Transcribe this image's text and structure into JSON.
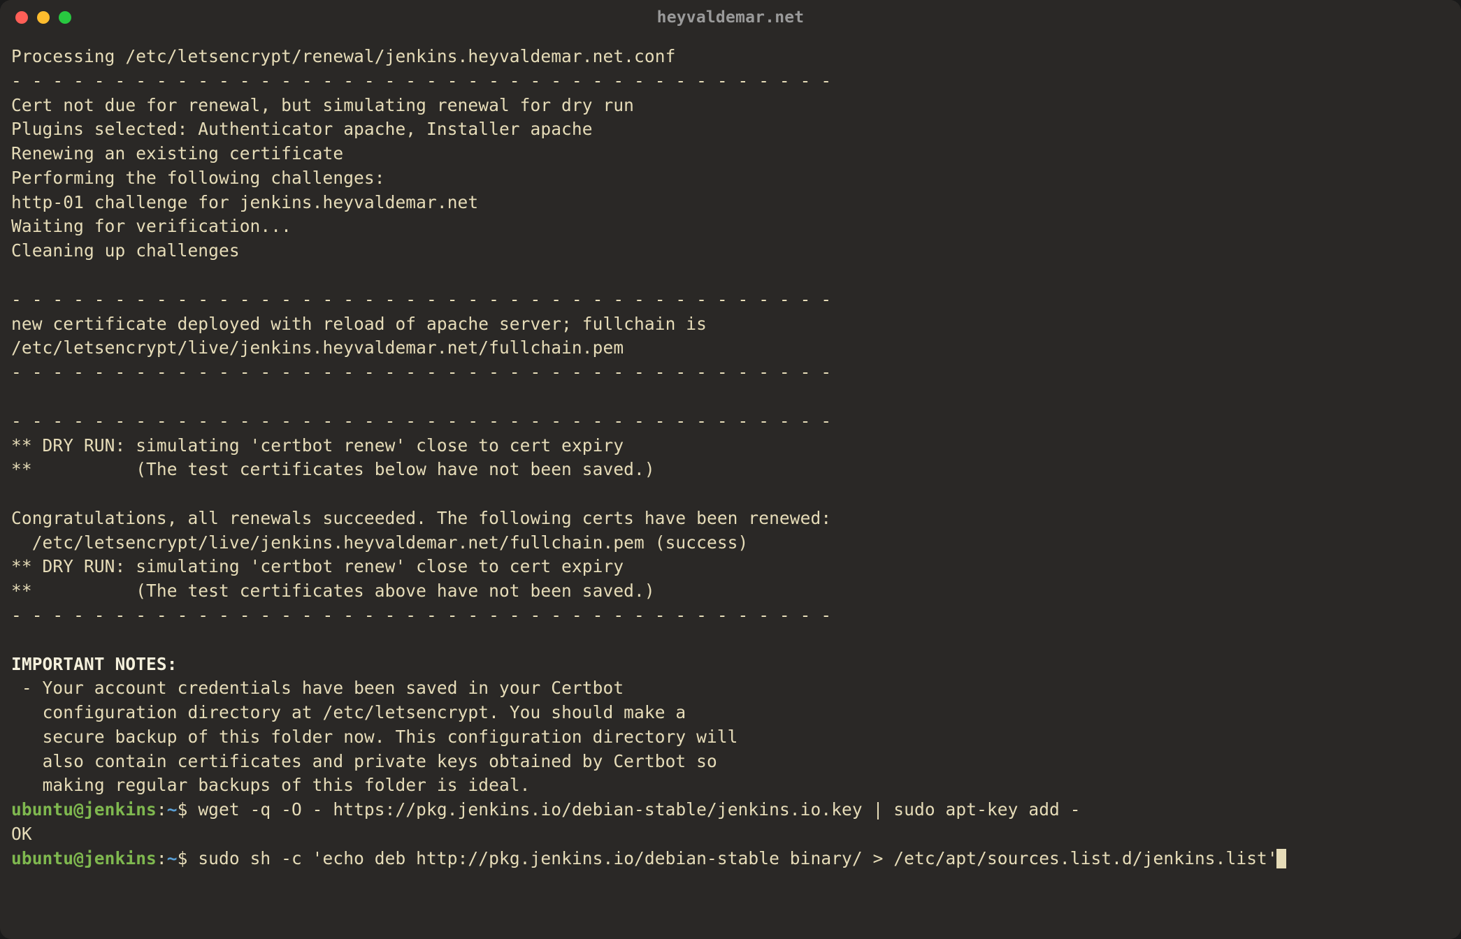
{
  "window": {
    "title": "heyvaldemar.net"
  },
  "output": {
    "line1": "Processing /etc/letsencrypt/renewal/jenkins.heyvaldemar.net.conf",
    "dash1": "- - - - - - - - - - - - - - - - - - - - - - - - - - - - - - - - - - - - - - - -",
    "line2": "Cert not due for renewal, but simulating renewal for dry run",
    "line3": "Plugins selected: Authenticator apache, Installer apache",
    "line4": "Renewing an existing certificate",
    "line5": "Performing the following challenges:",
    "line6": "http-01 challenge for jenkins.heyvaldemar.net",
    "line7": "Waiting for verification...",
    "line8": "Cleaning up challenges",
    "blank1": "",
    "dash2": "- - - - - - - - - - - - - - - - - - - - - - - - - - - - - - - - - - - - - - - -",
    "line9": "new certificate deployed with reload of apache server; fullchain is",
    "line10": "/etc/letsencrypt/live/jenkins.heyvaldemar.net/fullchain.pem",
    "dash3": "- - - - - - - - - - - - - - - - - - - - - - - - - - - - - - - - - - - - - - - -",
    "blank2": "",
    "dash4": "- - - - - - - - - - - - - - - - - - - - - - - - - - - - - - - - - - - - - - - -",
    "line11": "** DRY RUN: simulating 'certbot renew' close to cert expiry",
    "line12": "**          (The test certificates below have not been saved.)",
    "blank3": "",
    "line13": "Congratulations, all renewals succeeded. The following certs have been renewed:",
    "line14": "  /etc/letsencrypt/live/jenkins.heyvaldemar.net/fullchain.pem (success)",
    "line15": "** DRY RUN: simulating 'certbot renew' close to cert expiry",
    "line16": "**          (The test certificates above have not been saved.)",
    "dash5": "- - - - - - - - - - - - - - - - - - - - - - - - - - - - - - - - - - - - - - - -",
    "blank4": "",
    "notes_header": "IMPORTANT NOTES:",
    "note1": " - Your account credentials have been saved in your Certbot",
    "note2": "   configuration directory at /etc/letsencrypt. You should make a",
    "note3": "   secure backup of this folder now. This configuration directory will",
    "note4": "   also contain certificates and private keys obtained by Certbot so",
    "note5": "   making regular backups of this folder is ideal."
  },
  "prompts": [
    {
      "user_host": "ubuntu@jenkins",
      "colon": ":",
      "path": "~",
      "dollar": "$ ",
      "command": "wget -q -O - https://pkg.jenkins.io/debian-stable/jenkins.io.key | sudo apt-key add -"
    },
    {
      "result": "OK"
    },
    {
      "user_host": "ubuntu@jenkins",
      "colon": ":",
      "path": "~",
      "dollar": "$ ",
      "command": "sudo sh -c 'echo deb http://pkg.jenkins.io/debian-stable binary/ > /etc/apt/sources.list.d/jenkins.list'"
    }
  ]
}
